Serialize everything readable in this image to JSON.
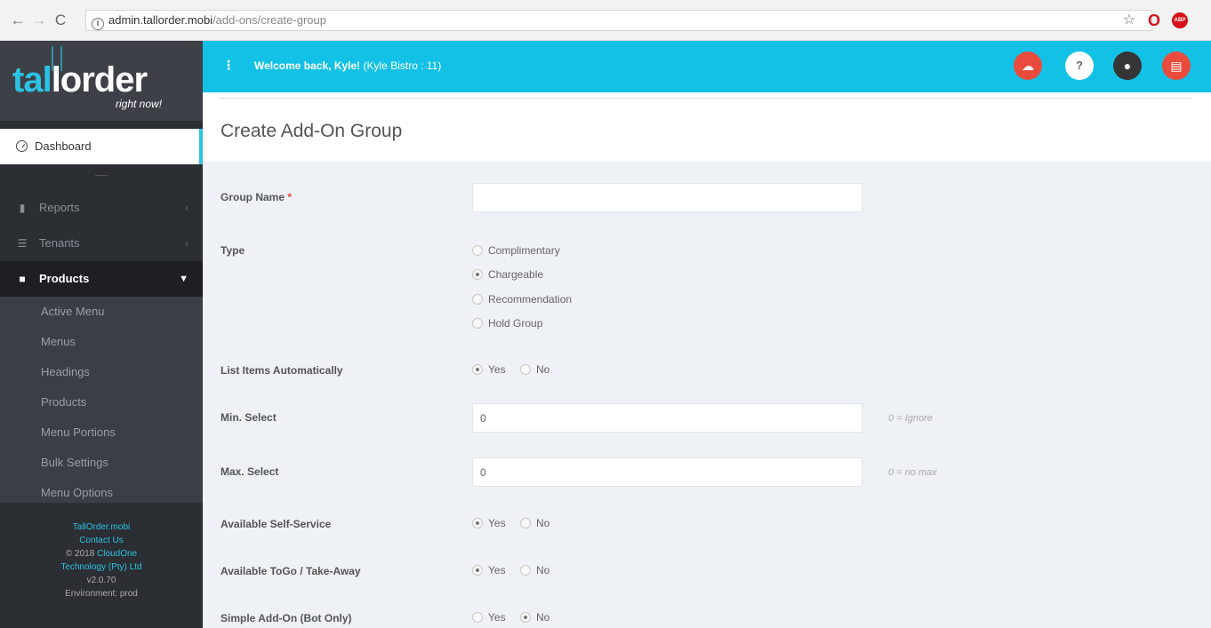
{
  "browser": {
    "url_host": "admin.tallorder.mobi",
    "url_path": "/add-ons/create-group"
  },
  "logo": {
    "brand_a": "tal",
    "brand_b": "lorder",
    "tagline": "right now!"
  },
  "sidebar": {
    "dashboard": "Dashboard",
    "reports": "Reports",
    "tenants": "Tenants",
    "products": "Products",
    "submenu": [
      "Active Menu",
      "Menus",
      "Headings",
      "Products",
      "Menu Portions",
      "Bulk Settings",
      "Menu Options"
    ],
    "footer": {
      "site": "TallOrder.mobi",
      "contact": "Contact Us",
      "copyright": "© 2018",
      "company_a": "CloudOne",
      "company_b": "Technology (Pty) Ltd",
      "version": "v2.0.70",
      "environment": "Environment: prod"
    }
  },
  "header": {
    "welcome": "Welcome back, Kyle!",
    "venue": "(Kyle Bistro : 11)"
  },
  "page": {
    "title": "Create Add-On Group"
  },
  "form": {
    "group_name_label": "Group Name",
    "required_mark": "*",
    "group_name_value": "",
    "type_label": "Type",
    "type_options": [
      "Complimentary",
      "Chargeable",
      "Recommendation",
      "Hold Group"
    ],
    "type_selected": "Chargeable",
    "list_items_label": "List Items Automatically",
    "min_label": "Min. Select",
    "min_value": "0",
    "min_hint": "0 = Ignore",
    "max_label": "Max. Select",
    "max_value": "0",
    "max_hint": "0 = no max",
    "self_service_label": "Available Self-Service",
    "togo_label": "Available ToGo / Take-Away",
    "simple_label": "Simple Add-On (Bot Only)",
    "yes": "Yes",
    "no": "No"
  }
}
